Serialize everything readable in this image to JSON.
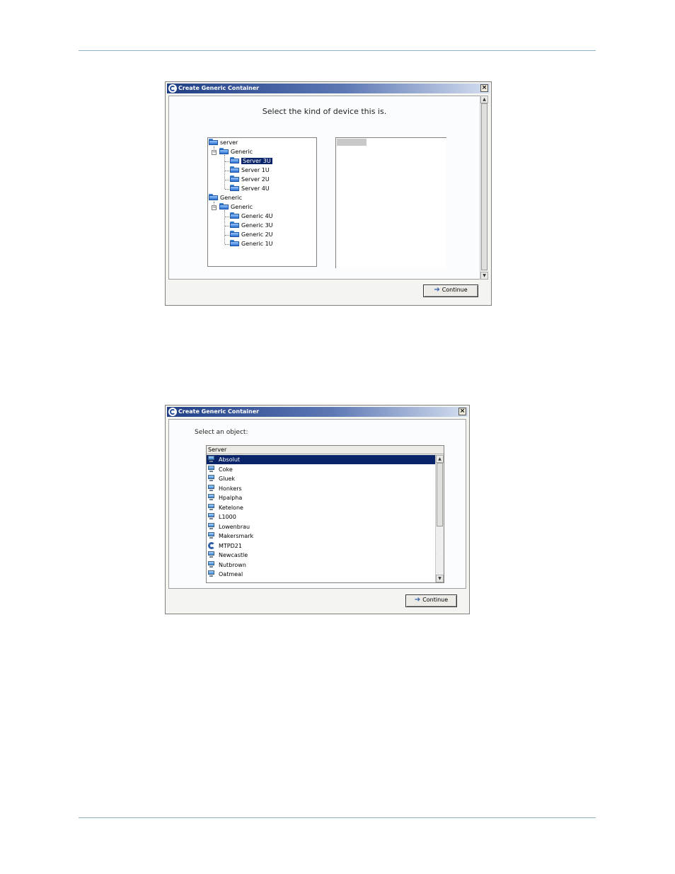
{
  "dialog1": {
    "title": "Create Generic Container",
    "close_label": "×",
    "prompt": "Select the kind of device this is.",
    "tree": {
      "server_root": "server",
      "server_group": "Generic",
      "server_items": [
        "Server 3U",
        "Server 1U",
        "Server 2U",
        "Server 4U"
      ],
      "generic_root": "Generic",
      "generic_group": "Generic",
      "generic_items": [
        "Generic 4U",
        "Generic 3U",
        "Generic 2U",
        "Generic 1U"
      ],
      "selected": "Server 3U"
    },
    "continue_label": "Continue"
  },
  "dialog2": {
    "title": "Create Generic Container",
    "close_label": "×",
    "prompt": "Select an object:",
    "list_header": "Server",
    "items": [
      "Absolut",
      "Coke",
      "Gluek",
      "Honkers",
      "Hpalpha",
      "Ketelone",
      "L1000",
      "Lowenbrau",
      "Makersmark",
      "MTPD21",
      "Newcastle",
      "Nutbrown",
      "Oatmeal"
    ],
    "item_icons": [
      "pc-icon",
      "pc-icon",
      "pc-icon",
      "pc-icon",
      "pc-icon",
      "pc-icon",
      "pc-icon",
      "pc-icon",
      "pc-icon",
      "compellent-icon",
      "pc-icon",
      "pc-icon",
      "pc-icon"
    ],
    "selected": "Absolut",
    "continue_label": "Continue"
  },
  "colors": {
    "title_gradient_start": "#203f86",
    "selection": "#0a246a",
    "rule": "#8fb3c4"
  }
}
